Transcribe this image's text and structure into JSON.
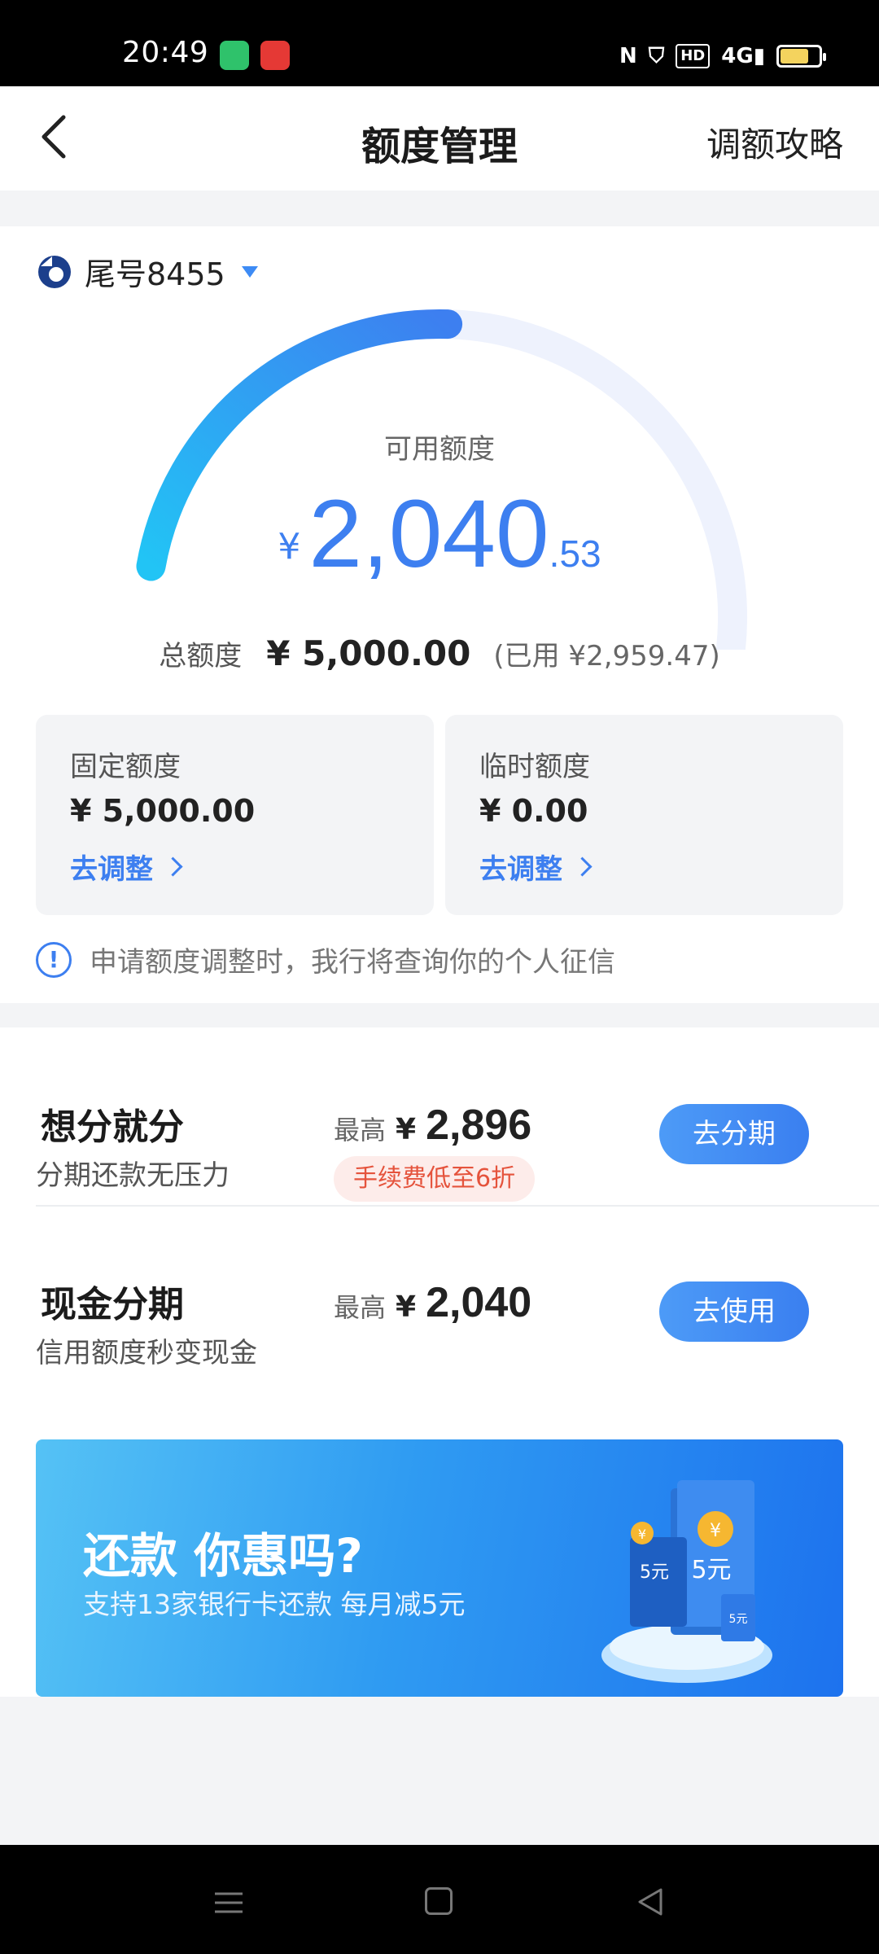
{
  "status_bar": {
    "time": "20:49",
    "icons": [
      "app-green-icon",
      "app-red-icon",
      "nfc-icon",
      "shield-icon",
      "hd-icon",
      "signal-4g-icon",
      "battery-icon"
    ],
    "hd_label": "HD",
    "signal_label": "4G"
  },
  "header": {
    "title": "额度管理",
    "right_link": "调额攻略"
  },
  "card": {
    "number_label": "尾号8455"
  },
  "credit": {
    "available_label": "可用额度",
    "currency": "¥",
    "available_int": "2,040",
    "available_dec": ".53",
    "used_fraction": 0.592,
    "total_label": "总额度",
    "total_value": "¥ 5,000.00",
    "used_text": "(已用 ¥2,959.47)"
  },
  "limits": [
    {
      "label": "固定额度",
      "value": "¥ 5,000.00",
      "link": "去调整"
    },
    {
      "label": "临时额度",
      "value": "¥ 0.00",
      "link": "去调整"
    }
  ],
  "notice": {
    "text": "申请额度调整时，我行将查询你的个人征信"
  },
  "offers": [
    {
      "title": "想分就分",
      "subtitle": "分期还款无压力",
      "max_label": "最高",
      "currency": "¥",
      "max_value": "2,896",
      "tag": "手续费低至6折",
      "button": "去分期"
    },
    {
      "title": "现金分期",
      "subtitle": "信用额度秒变现金",
      "max_label": "最高",
      "currency": "¥",
      "max_value": "2,040",
      "button": "去使用"
    }
  ],
  "banner": {
    "title": "还款 你惠吗?",
    "subtitle": "支持13家银行卡还款 每月减5元",
    "art_labels": [
      "5元",
      "5元",
      "5元",
      "¥",
      "¥"
    ]
  },
  "colors": {
    "accent": "#3d7ff0",
    "gauge_start": "#22c4f5",
    "gauge_end": "#3d7ff0",
    "gauge_track": "#eef2fd",
    "tag_bg": "#fdecea",
    "tag_text": "#e5533c"
  }
}
